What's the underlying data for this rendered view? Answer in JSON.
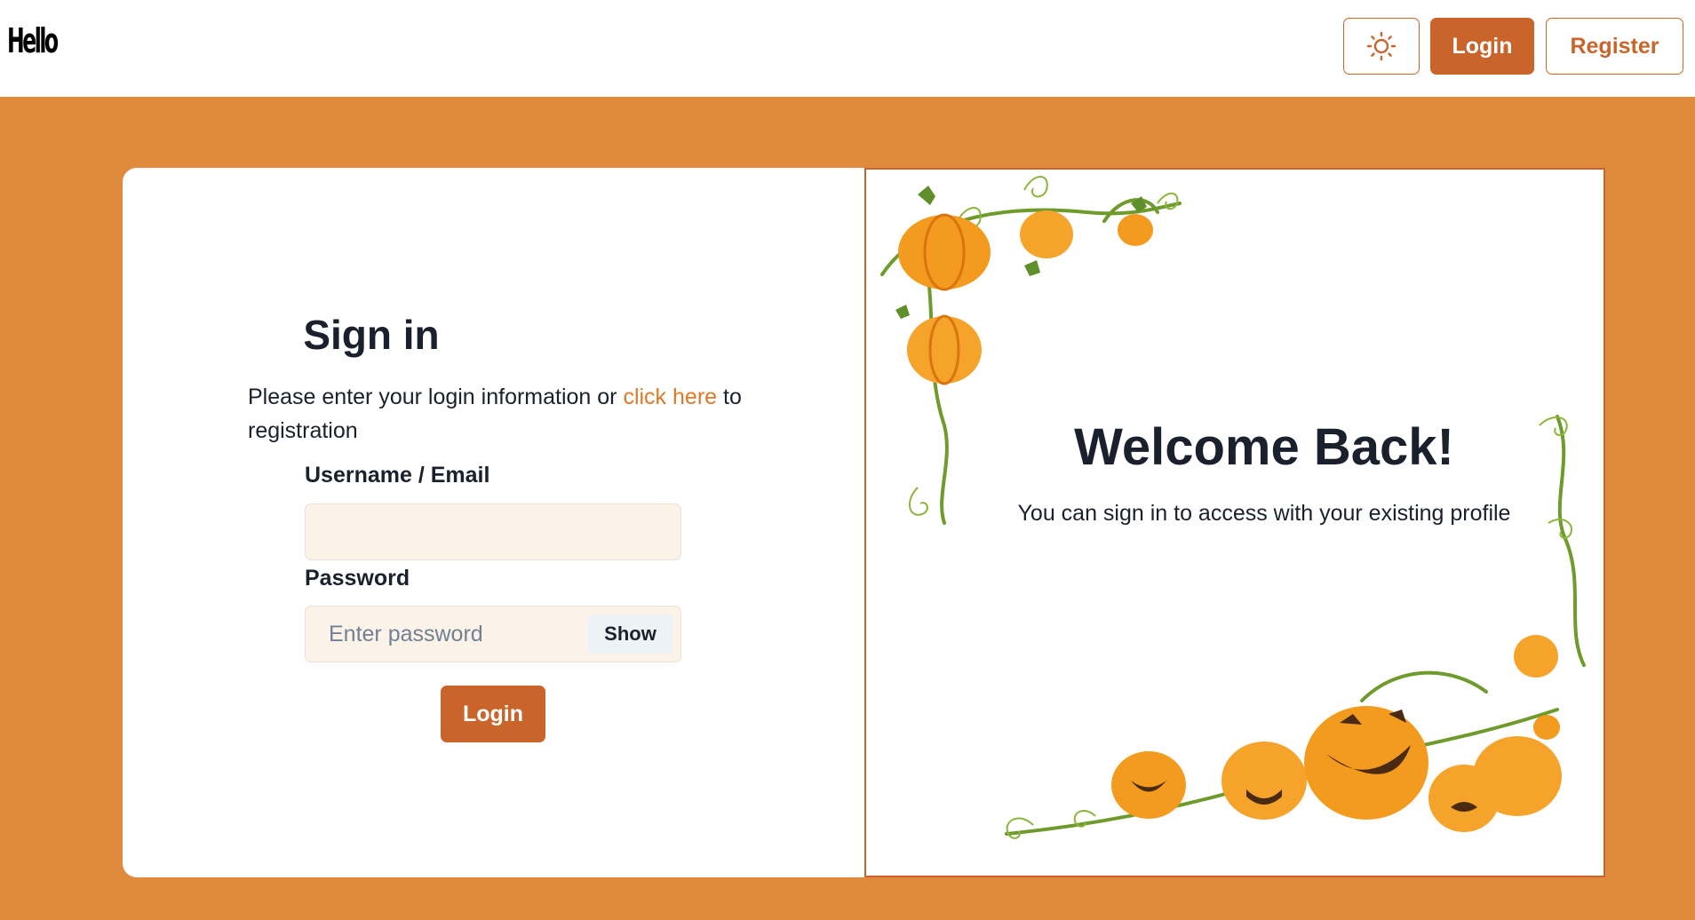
{
  "header": {
    "logo_text": "Hello",
    "theme_toggle_icon": "sun-icon",
    "login_label": "Login",
    "register_label": "Register"
  },
  "signin": {
    "title": "Sign in",
    "intro_text": "Please enter your login information or ",
    "intro_link": "click here",
    "intro_suffix": " to registration",
    "username_label": "Username / Email",
    "username_value": "",
    "password_label": "Password",
    "password_placeholder": "Enter password",
    "show_label": "Show",
    "submit_label": "Login"
  },
  "welcome": {
    "title": "Welcome Back!",
    "subtitle": "You can sign in to access with your existing profile"
  },
  "colors": {
    "accent": "#c9652b",
    "background": "#e08a3e",
    "input_bg": "#fcf3e8",
    "link": "#dd7a2a"
  }
}
